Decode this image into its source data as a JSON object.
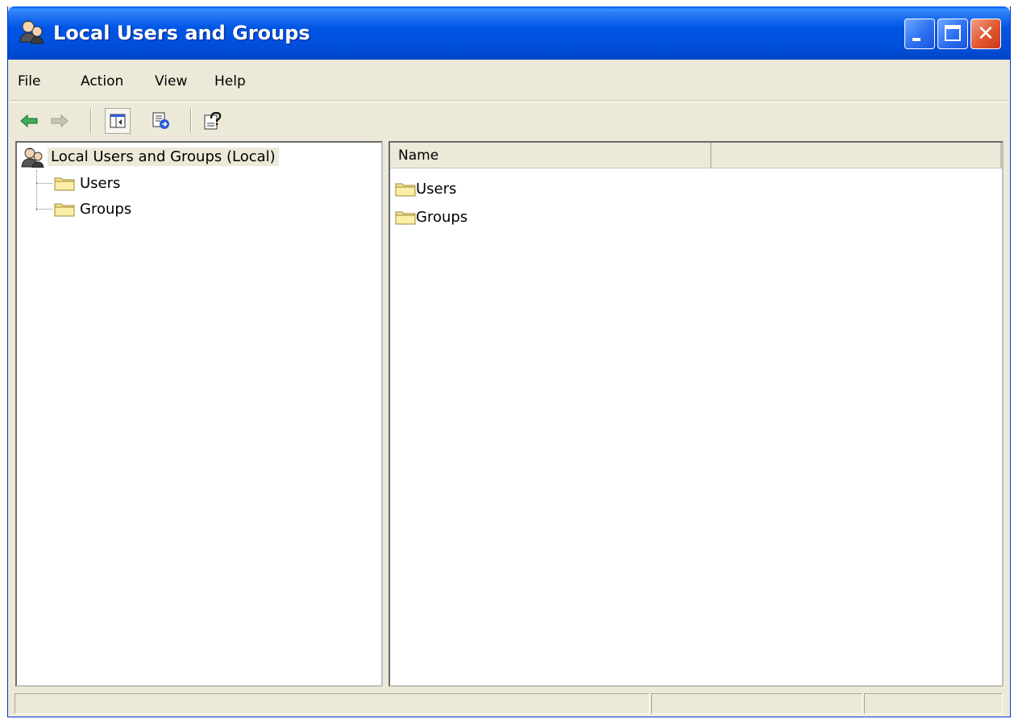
{
  "window": {
    "title": "Local Users and Groups",
    "icon": "users-groups-icon",
    "controls": [
      "minimize-icon",
      "maximize-icon",
      "close-icon"
    ]
  },
  "menu": {
    "items": [
      "File",
      "Action",
      "View",
      "Help"
    ]
  },
  "toolbar": {
    "buttons": [
      "back-arrow-icon",
      "forward-arrow-icon",
      "show-hide-console-tree-icon",
      "export-list-icon",
      "help-icon"
    ]
  },
  "tree": {
    "root": "Local Users and Groups (Local)",
    "children": [
      "Users",
      "Groups"
    ]
  },
  "list": {
    "columns": [
      "Name",
      ""
    ],
    "items": [
      "Users",
      "Groups"
    ]
  },
  "close_glyph": "✕",
  "colors": {
    "titlebar": "#0054e3",
    "chrome": "#ece9d8",
    "close_button": "#e0552e",
    "folder": "#f6e38a"
  }
}
